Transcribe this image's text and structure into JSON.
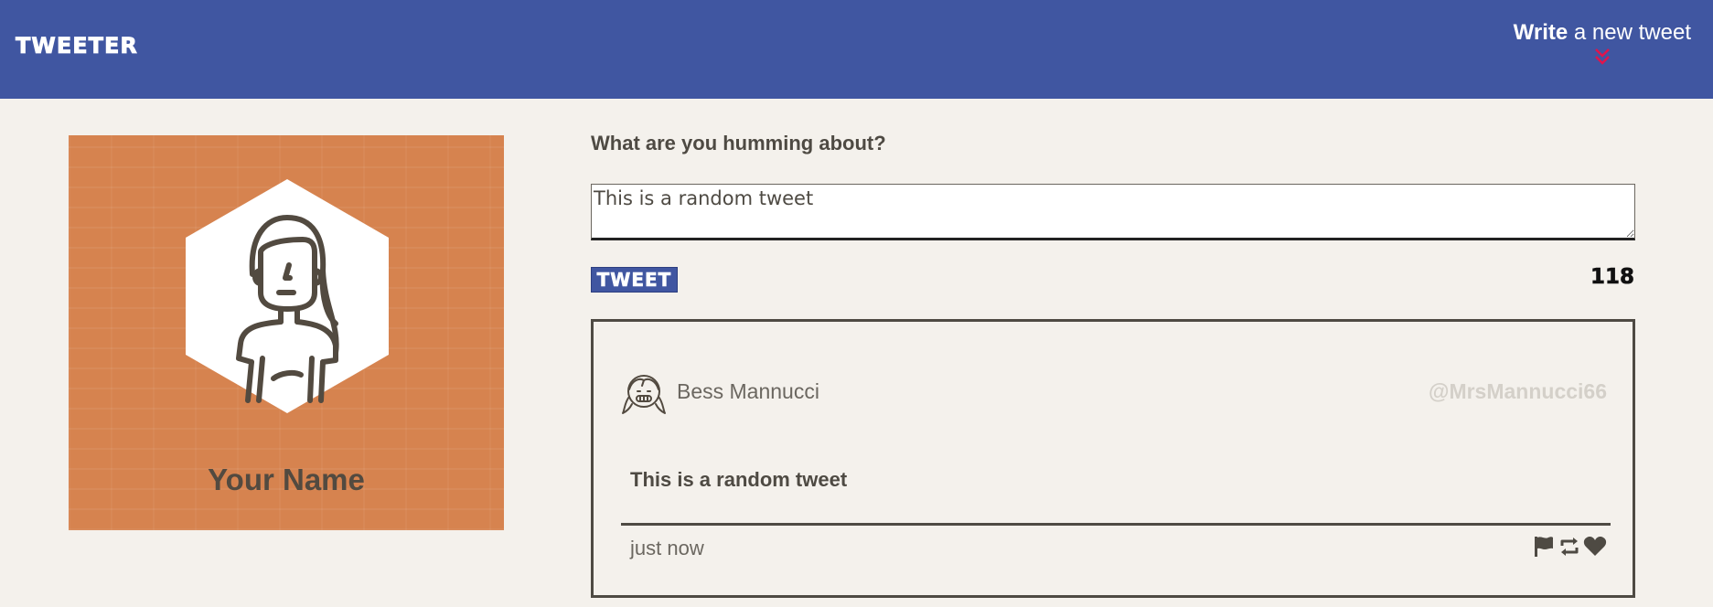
{
  "nav": {
    "brand": "TWEETER",
    "write_bold": "Write",
    "write_rest": " a new tweet",
    "chevron_icon": "double-chevron-down-icon",
    "chevron_color": "#e0144c",
    "background": "#4056a1"
  },
  "profile": {
    "name": "Your Name",
    "avatar_icon": "girl-avatar-icon",
    "card_color": "#d6834f"
  },
  "compose": {
    "label": "What are you humming about?",
    "input_value": "This is a random tweet",
    "tweet_button": "TWEET",
    "counter": "118"
  },
  "tweets": [
    {
      "avatar_icon": "smiling-girl-avatar-icon",
      "author": "Bess Mannucci",
      "handle": "@MrsMannucci66",
      "content": "This is a random tweet",
      "time": "just now",
      "actions": [
        "flag-icon",
        "retweet-icon",
        "heart-icon"
      ]
    }
  ]
}
